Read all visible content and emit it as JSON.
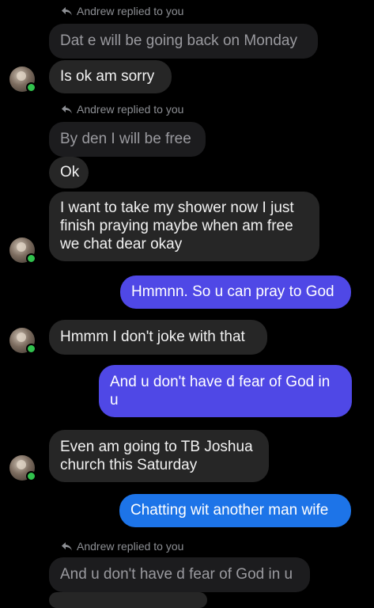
{
  "thread": {
    "reply_label_1": "Andrew replied to you",
    "quoted_1": "Dat e will be going back on Monday",
    "msg_1": "Is ok am sorry",
    "reply_label_2": "Andrew replied to you",
    "quoted_2": "By den I will be free",
    "msg_2": "Ok",
    "msg_3_lines": [
      "I want to take my shower now I just",
      "finish praying maybe when am free",
      "we chat dear okay"
    ],
    "sent_1": "Hmmnn. So u can pray to God",
    "msg_4": "Hmmm I don't joke with that",
    "sent_2_lines": [
      "And u don't have d fear of God in",
      "u"
    ],
    "msg_5_lines": [
      "Even am going to TB Joshua",
      "church this Saturday"
    ],
    "sent_3": "Chatting wit another man wife",
    "reply_label_3": "Andrew replied to you",
    "quoted_3": "And u don't have d fear of God in u"
  },
  "colors": {
    "background": "#000000",
    "incoming_bubble": "#262626",
    "quoted_bubble": "#1c1c1e",
    "outgoing_purple": "#4f48e6",
    "outgoing_blue": "#1d74e8",
    "online_dot": "#31c24d"
  },
  "icons": {
    "reply": "reply-arrow-icon",
    "presence": "online-status-icon"
  }
}
